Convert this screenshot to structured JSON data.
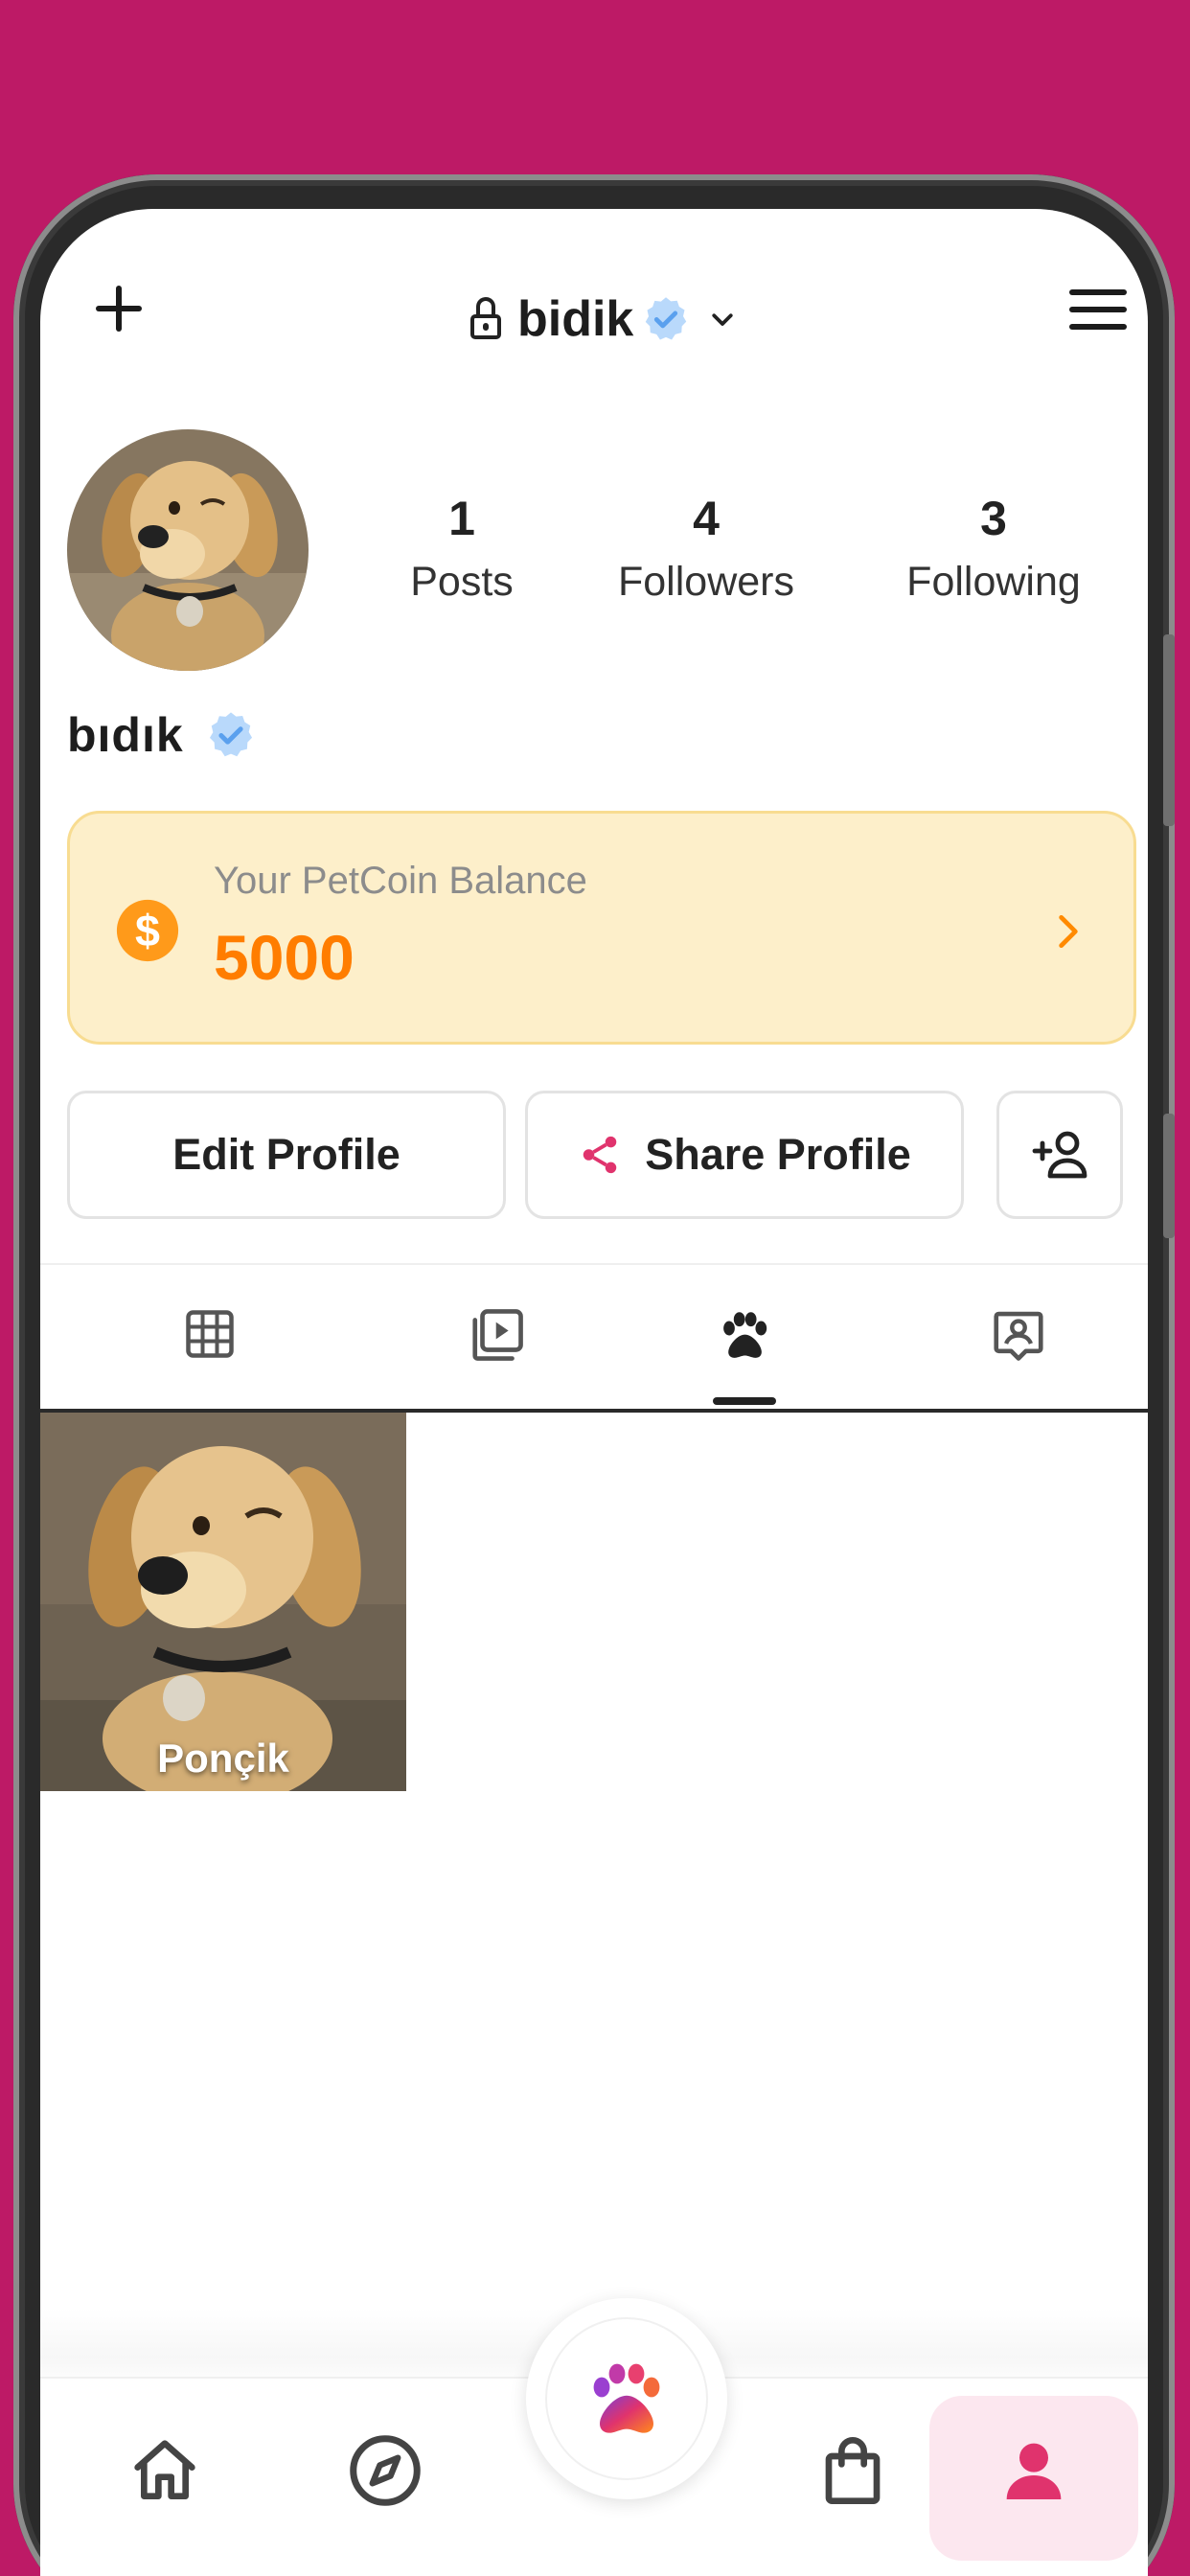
{
  "header": {
    "account_name": "bidik",
    "icons": [
      "plus-icon",
      "lock-icon",
      "verified-icon",
      "chevron-down-icon",
      "menu-icon"
    ]
  },
  "profile": {
    "display_name": "bıdık",
    "stats": [
      {
        "value": "1",
        "label": "Posts"
      },
      {
        "value": "4",
        "label": "Followers"
      },
      {
        "value": "3",
        "label": "Following"
      }
    ]
  },
  "coins": {
    "label": "Your PetCoin Balance",
    "value": "5000"
  },
  "actions": {
    "edit_label": "Edit Profile",
    "share_label": "Share Profile"
  },
  "tabs": {
    "items": [
      "grid-icon",
      "reels-icon",
      "paw-icon",
      "tagged-icon"
    ],
    "active": "paw-icon"
  },
  "posts": [
    {
      "caption": "Ponçik"
    }
  ],
  "bottom_nav": {
    "items": [
      "home-icon",
      "explore-icon",
      "paw-fab-icon",
      "shop-bag-icon",
      "profile-icon"
    ],
    "active": "profile-icon"
  },
  "colors": {
    "background": "#bd1a66",
    "accent": "#e0336d",
    "coin_text": "#ff7d00",
    "coin_card": "#fdefca",
    "verified": "#5aa0ee"
  }
}
